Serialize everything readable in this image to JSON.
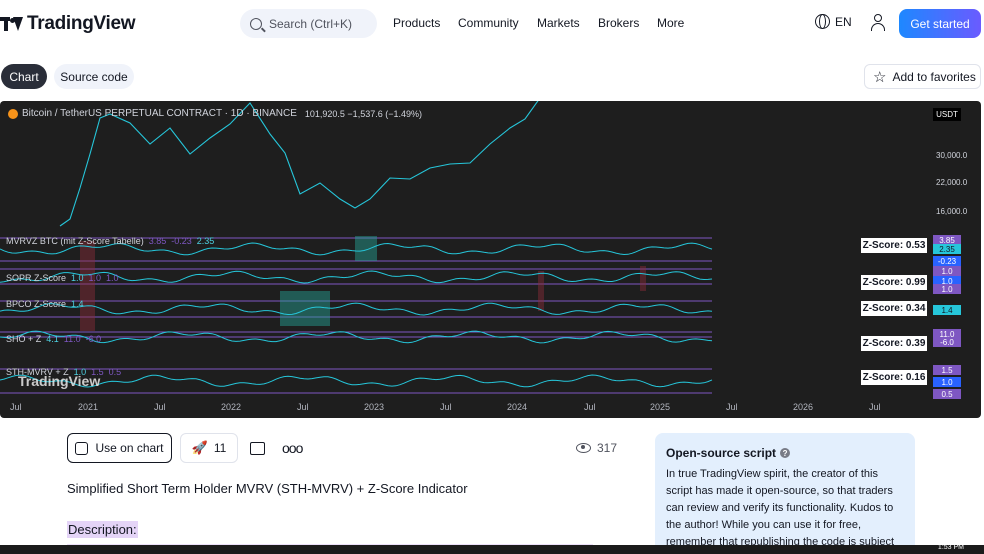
{
  "header": {
    "logo_text": "TradingView",
    "search_placeholder": "Search (Ctrl+K)",
    "nav": [
      "Products",
      "Community",
      "Markets",
      "Brokers",
      "More"
    ],
    "language": "EN",
    "cta": "Get started"
  },
  "tabs": {
    "chart": "Chart",
    "source": "Source code"
  },
  "favorites_label": "Add to favorites",
  "chart": {
    "symbol": "Bitcoin / TetherUS PERPETUAL CONTRACT · 1D · BINANCE",
    "quote": "101,920.5  −1,537.6 (−1.49%)",
    "currency": "USDT",
    "price_ticks": [
      "30,000.0",
      "22,000.0",
      "16,000.0"
    ],
    "watermark": "TradingView",
    "indicators": [
      {
        "label": "MVRVZ BTC (mit Z-Score Tabelle)",
        "vals": [
          "3.85",
          "-0.23",
          "2.35"
        ],
        "z": "Z-Score: 0.53",
        "tags": [
          "3.85",
          "2.35",
          "-0.23"
        ]
      },
      {
        "label": "SOPR Z-Score",
        "vals": [
          "1.0",
          "1.0",
          "1.0"
        ],
        "z": "Z-Score: 0.99",
        "tags": [
          "1.0",
          "1.0",
          "1.0"
        ]
      },
      {
        "label": "BPCO Z-Score",
        "vals": [
          "1.4"
        ],
        "z": "Z-Score: 0.34",
        "tags": [
          "1.4"
        ]
      },
      {
        "label": "SHO + Z",
        "vals": [
          "4.1",
          "11.0",
          "-6.0"
        ],
        "z": "Z-Score: 0.39",
        "tags": [
          "11.0",
          "-6.0"
        ]
      },
      {
        "label": "STH-MVRV + Z",
        "vals": [
          "1.0",
          "1.5",
          "0.5"
        ],
        "z": "Z-Score: 0.16",
        "tags": [
          "1.5",
          "1.0",
          "0.5"
        ]
      }
    ],
    "time_ticks": [
      "Jul",
      "2021",
      "Jul",
      "2022",
      "Jul",
      "2023",
      "Jul",
      "2024",
      "Jul",
      "2025",
      "Jul",
      "2026",
      "Jul"
    ]
  },
  "actions": {
    "use_on_chart": "Use on chart",
    "boosts": "11",
    "views": "317"
  },
  "script_title": "Simplified Short Term Holder MVRV (STH-MVRV) + Z-Score Indicator",
  "description_label": "Description:",
  "open_source": {
    "title": "Open-source script",
    "body": "In true TradingView spirit, the creator of this script has made it open-source, so that traders can review and verify its functionality. Kudos to the author! While you can use it for free, remember that republishing the code is subject"
  },
  "taskbar_time": "1:53 PM",
  "colors": {
    "accent": "#2962ff",
    "line": "#26c6da",
    "band": "#7e57c2",
    "tag_blue": "#2962ff",
    "tag_purple": "#7e57c2"
  }
}
